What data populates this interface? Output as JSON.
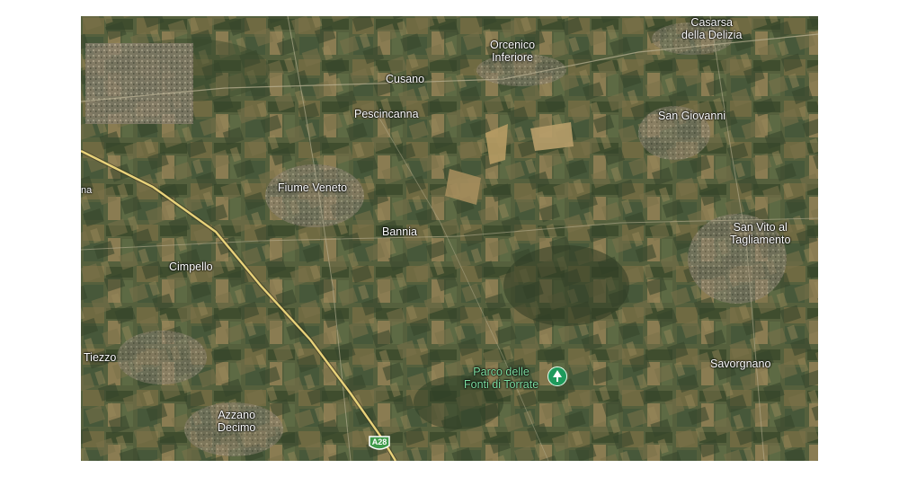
{
  "map": {
    "type": "satellite",
    "places": {
      "casarsa": "Casarsa\ndella Delizia",
      "orcenico": "Orcenico\nInferiore",
      "cusano": "Cusano",
      "pescincanna": "Pescincanna",
      "san_giovanni": "San Giovanni",
      "fiume_veneto": "Fiume Veneto",
      "bannia": "Bannia",
      "san_vito": "San Vito al\nTagliamento",
      "cimpello": "Cimpello",
      "tiezzo": "Tiezzo",
      "savorgnano": "Savorgnano",
      "azzano": "Azzano\nDecimo",
      "edge_label": "na"
    },
    "park": {
      "label": "Parco delle\nFonti di Torrate",
      "icon": "tree-icon",
      "color": "#1e9a5c"
    },
    "highway": {
      "shield_label": "A28",
      "color": "#e8d27a"
    }
  }
}
